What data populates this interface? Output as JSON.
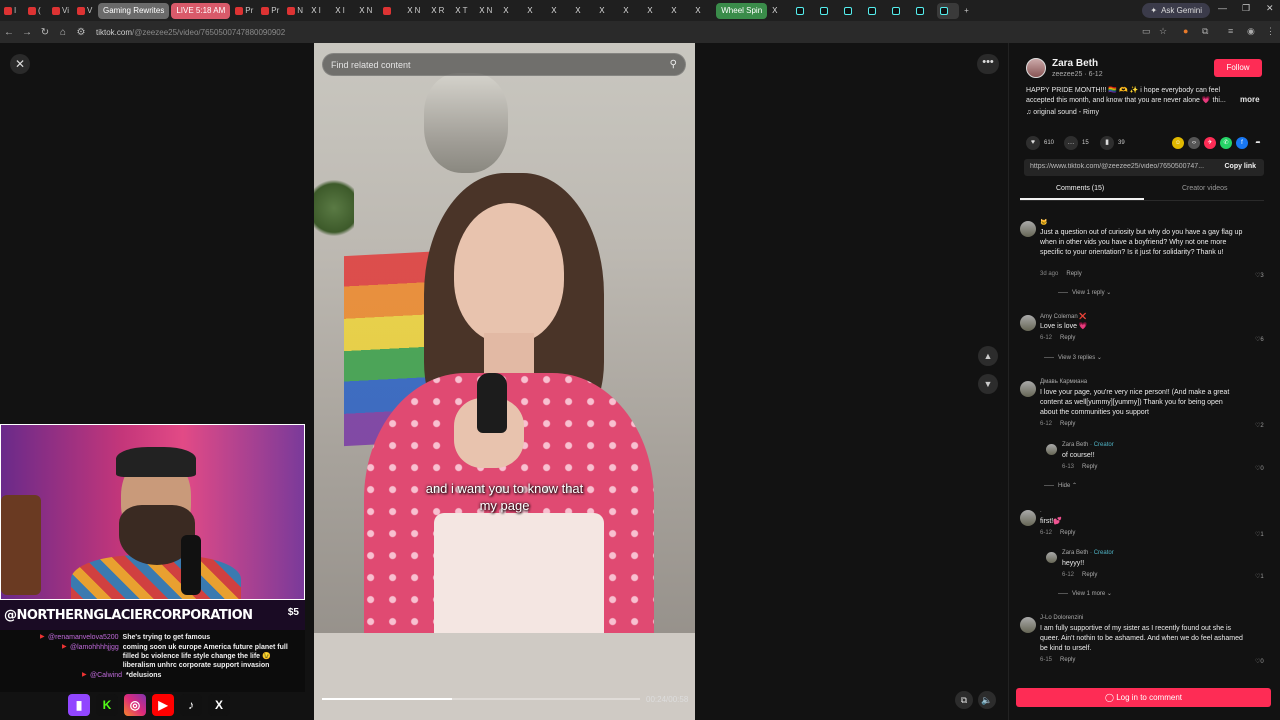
{
  "browser": {
    "tabs": [
      {
        "label": "I",
        "kind": "yt"
      },
      {
        "label": "( ",
        "kind": "yt"
      },
      {
        "label": "Vi",
        "kind": "yt"
      },
      {
        "label": "V",
        "kind": "yt"
      },
      {
        "label": "Gaming Rewrites",
        "kind": "pill-gray"
      },
      {
        "label": "LIVE 5:18 AM",
        "kind": "pill-red"
      },
      {
        "label": "Pr",
        "kind": "yt"
      },
      {
        "label": "Pr",
        "kind": "yt"
      },
      {
        "label": "N",
        "kind": "yt"
      },
      {
        "label": "I",
        "kind": "x"
      },
      {
        "label": "I",
        "kind": "x"
      },
      {
        "label": "N",
        "kind": "x"
      },
      {
        "label": "",
        "kind": "yt"
      },
      {
        "label": "N",
        "kind": "x"
      },
      {
        "label": "R",
        "kind": "x"
      },
      {
        "label": "T",
        "kind": "x"
      },
      {
        "label": "N",
        "kind": "x"
      },
      {
        "label": "",
        "kind": "x"
      },
      {
        "label": "",
        "kind": "x"
      },
      {
        "label": "",
        "kind": "x"
      },
      {
        "label": "",
        "kind": "x"
      },
      {
        "label": "",
        "kind": "x"
      },
      {
        "label": "",
        "kind": "x"
      },
      {
        "label": "",
        "kind": "x"
      },
      {
        "label": "",
        "kind": "x"
      },
      {
        "label": "",
        "kind": "x"
      },
      {
        "label": "Wheel Spin",
        "kind": "pill-green"
      },
      {
        "label": "",
        "kind": "x"
      },
      {
        "label": "",
        "kind": "tt"
      },
      {
        "label": "",
        "kind": "tt"
      },
      {
        "label": "",
        "kind": "tt"
      },
      {
        "label": "",
        "kind": "tt"
      },
      {
        "label": "",
        "kind": "tt"
      },
      {
        "label": "",
        "kind": "tt"
      },
      {
        "label": "",
        "kind": "tt"
      }
    ],
    "new_tab": "+",
    "ask_gemini": "Ask Gemini",
    "window_minimize": "—",
    "window_restore": "❐",
    "window_close": "✕",
    "url_host": "tiktok.com",
    "url_path": "/@zeezee25/video/7650500747880090902",
    "back": "←",
    "forward": "→",
    "reload": "↻",
    "home": "⌂"
  },
  "video": {
    "search_placeholder": "Find related content",
    "caption_line1": "and i want you to know that",
    "caption_line2": "my page",
    "timecode": "00:24/00:58",
    "progress": 0.41,
    "close_icon": "close-icon",
    "more_icon": "more-icon"
  },
  "stream": {
    "channel": "@NORTHERNGLACIERCORPORATION",
    "channel_number": "$5",
    "chat": [
      {
        "user": "@renamanvelova5200",
        "msg": "She's trying to get famous"
      },
      {
        "user": "@lamohhhhjjgg",
        "msg": "coming soon uk europe America future planet full filled bc violence life style change the life 😉 liberalism unhrc corporate support invasion"
      },
      {
        "user": "@Calwind",
        "msg": "*delusions"
      }
    ],
    "socials": [
      "twitch",
      "kick",
      "instagram",
      "youtube",
      "tiktok",
      "x"
    ]
  },
  "post": {
    "author": "Zara Beth",
    "handle_date": "zeezee25 · 6-12",
    "follow": "Follow",
    "description": "HAPPY PRIDE MONTH!!! 🏳️‍🌈 🫶 ✨ i hope everybody can feel accepted this month, and know that you are never alone 💗 thi...",
    "more": "more",
    "sound": "♫  original sound - Rimy",
    "likes": "610",
    "comments": "15",
    "saves": "39",
    "link": "https://www.tiktok.com/@zeezee25/video/7650500747...",
    "copy_link": "Copy link",
    "tab_comments": "Comments (15)",
    "tab_creator": "Creator videos",
    "login": "Log in to comment"
  },
  "comments": [
    {
      "name": "🐱",
      "text": "Just a question out of curiosity but why do you have a gay flag up when in other vids you have a boyfriend? Why not one more specific to your orientation? Is it just for solidarity? Thank u!",
      "date": "3d ago",
      "reply": "Reply",
      "likes": "3",
      "view": "View 1 reply ⌄"
    },
    {
      "name": "Amy Coleman ❌",
      "text": "Love is love 💗",
      "date": "6-12",
      "reply": "Reply",
      "likes": "6",
      "view": "View 3 replies ⌄"
    },
    {
      "name": "Дмавь Кармиана",
      "text": "I love your page, you're very nice person!! (And make a great content as well[yummy][yummy]) Thank you for being open about the communities you support",
      "date": "6-12",
      "reply": "Reply",
      "likes": "2"
    },
    {
      "name": "Zara Beth",
      "creator": " · Creator",
      "text": "of course!!",
      "date": "6-13",
      "reply": "Reply",
      "likes": "0",
      "hide": "Hide ⌃"
    },
    {
      "name": ".",
      "text": "first!💕",
      "date": "6-12",
      "reply": "Reply",
      "likes": "1"
    },
    {
      "name": "Zara Beth",
      "creator": " · Creator",
      "text": "heyyy!!",
      "date": "6-12",
      "reply": "Reply",
      "likes": "1",
      "view": "View 1 more ⌄"
    },
    {
      "name": "J-Lo Dolorenzini",
      "text": "I am fully supportive of my sister as I recently found out she is queer. Ain't nothin to be ashamed. And when we do feel ashamed be kind to urself.",
      "date": "6-15",
      "reply": "Reply",
      "likes": "0"
    }
  ]
}
